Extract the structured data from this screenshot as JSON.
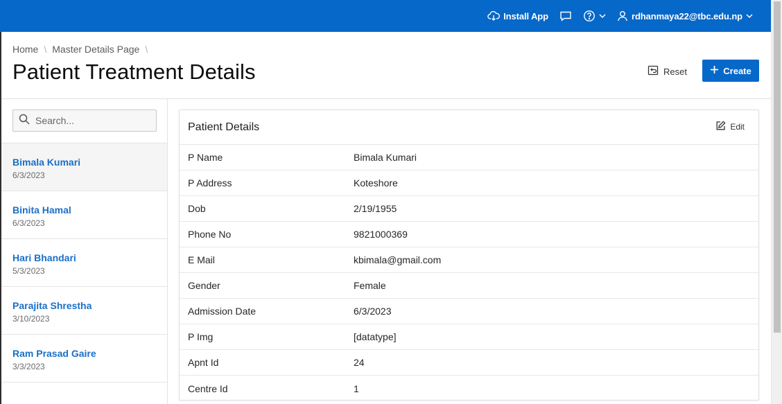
{
  "topbar": {
    "install_label": "Install App",
    "user_label": "rdhanmaya22@tbc.edu.np",
    "background": "#0668c9"
  },
  "breadcrumb": {
    "items": [
      "Home",
      "Master Details Page"
    ]
  },
  "page_title": "Patient Treatment Details",
  "actions": {
    "reset_label": "Reset",
    "create_label": "Create"
  },
  "search": {
    "placeholder": "Search..."
  },
  "patients": [
    {
      "name": "Bimala Kumari",
      "date": "6/3/2023",
      "selected": true
    },
    {
      "name": "Binita Hamal",
      "date": "6/3/2023"
    },
    {
      "name": "Hari Bhandari",
      "date": "5/3/2023"
    },
    {
      "name": "Parajita Shrestha",
      "date": "3/10/2023"
    },
    {
      "name": "Ram Prasad Gaire",
      "date": "3/3/2023"
    }
  ],
  "details": {
    "title": "Patient Details",
    "edit_label": "Edit",
    "fields": [
      {
        "label": "P Name",
        "value": "Bimala Kumari"
      },
      {
        "label": "P Address",
        "value": "Koteshore"
      },
      {
        "label": "Dob",
        "value": "2/19/1955"
      },
      {
        "label": "Phone No",
        "value": "9821000369"
      },
      {
        "label": "E Mail",
        "value": "kbimala@gmail.com"
      },
      {
        "label": "Gender",
        "value": "Female"
      },
      {
        "label": "Admission Date",
        "value": "6/3/2023"
      },
      {
        "label": "P Img",
        "value": "[datatype]"
      },
      {
        "label": "Apnt Id",
        "value": "24"
      },
      {
        "label": "Centre Id",
        "value": "1"
      }
    ]
  },
  "icons": {
    "install": "cloud-download-icon",
    "feedback": "chat-bubble-icon",
    "help": "question-circle-icon",
    "user": "user-icon",
    "reset": "reset-icon",
    "create": "plus-icon",
    "search": "search-icon",
    "edit": "pencil-edit-icon"
  }
}
